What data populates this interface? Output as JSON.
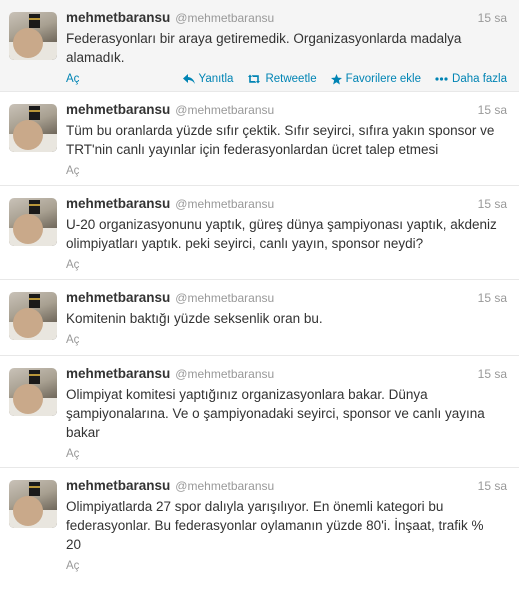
{
  "tweets": [
    {
      "fullname": "mehmetbaransu",
      "username": "@mehmetbaransu",
      "time": "15 sa",
      "text": "Federasyonları bir araya getiremedik. Organizasyonlarda madalya alamadık.",
      "expand": "Aç",
      "actions": {
        "reply": "Yanıtla",
        "retweet": "Retweetle",
        "favorite": "Favorilere ekle",
        "more": "Daha fazla"
      }
    },
    {
      "fullname": "mehmetbaransu",
      "username": "@mehmetbaransu",
      "time": "15 sa",
      "text": "Tüm bu oranlarda yüzde sıfır çektik. Sıfır seyirci, sıfıra yakın sponsor ve TRT'nin canlı yayınlar için federasyonlardan ücret talep etmesi",
      "expand": "Aç"
    },
    {
      "fullname": "mehmetbaransu",
      "username": "@mehmetbaransu",
      "time": "15 sa",
      "text": "U-20 organizasyonunu yaptık, güreş dünya şampiyonası yaptık, akdeniz olimpiyatları yaptık. peki seyirci, canlı yayın, sponsor neydi?",
      "expand": "Aç"
    },
    {
      "fullname": "mehmetbaransu",
      "username": "@mehmetbaransu",
      "time": "15 sa",
      "text": "Komitenin baktığı yüzde seksenlik oran bu.",
      "expand": "Aç"
    },
    {
      "fullname": "mehmetbaransu",
      "username": "@mehmetbaransu",
      "time": "15 sa",
      "text": "Olimpiyat komitesi yaptığınız organizasyonlara bakar. Dünya şampiyonalarına. Ve o şampiyonadaki seyirci, sponsor ve canlı yayına bakar",
      "expand": "Aç"
    },
    {
      "fullname": "mehmetbaransu",
      "username": "@mehmetbaransu",
      "time": "15 sa",
      "text": "Olimpiyatlarda 27 spor dalıyla yarışılıyor. En önemli kategori bu federasyonlar. Bu federasyonlar oylamanın yüzde 80'i. İnşaat, trafik % 20",
      "expand": "Aç"
    }
  ]
}
